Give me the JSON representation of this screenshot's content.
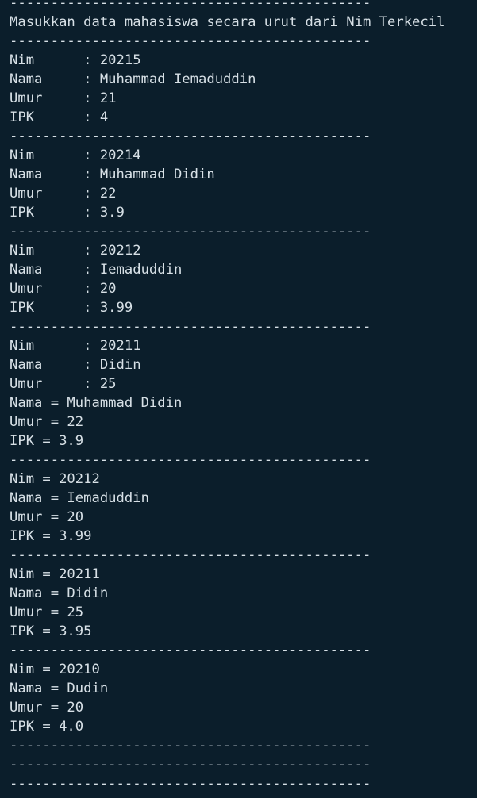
{
  "terminal": {
    "lines": [
      "--------------------------------------------",
      "Masukkan data mahasiswa secara urut dari Nim Terkecil",
      "--------------------------------------------",
      "Nim      : 20215",
      "Nama     : Muhammad Iemaduddin",
      "Umur     : 21",
      "IPK      : 4",
      "--------------------------------------------",
      "Nim      : 20214",
      "Nama     : Muhammad Didin",
      "Umur     : 22",
      "IPK      : 3.9",
      "--------------------------------------------",
      "Nim      : 20212",
      "Nama     : Iemaduddin",
      "Umur     : 20",
      "IPK      : 3.99",
      "--------------------------------------------",
      "Nim      : 20211",
      "Nama     : Didin",
      "Umur     : 25",
      "Nama = Muhammad Didin",
      "Umur = 22",
      "IPK = 3.9",
      "--------------------------------------------",
      "Nim = 20212",
      "Nama = Iemaduddin",
      "Umur = 20",
      "IPK = 3.99",
      "--------------------------------------------",
      "Nim = 20211",
      "Nama = Didin",
      "Umur = 25",
      "IPK = 3.95",
      "--------------------------------------------",
      "Nim = 20210",
      "Nama = Dudin",
      "Umur = 20",
      "IPK = 4.0",
      "--------------------------------------------",
      "--------------------------------------------",
      "--------------------------------------------"
    ]
  }
}
